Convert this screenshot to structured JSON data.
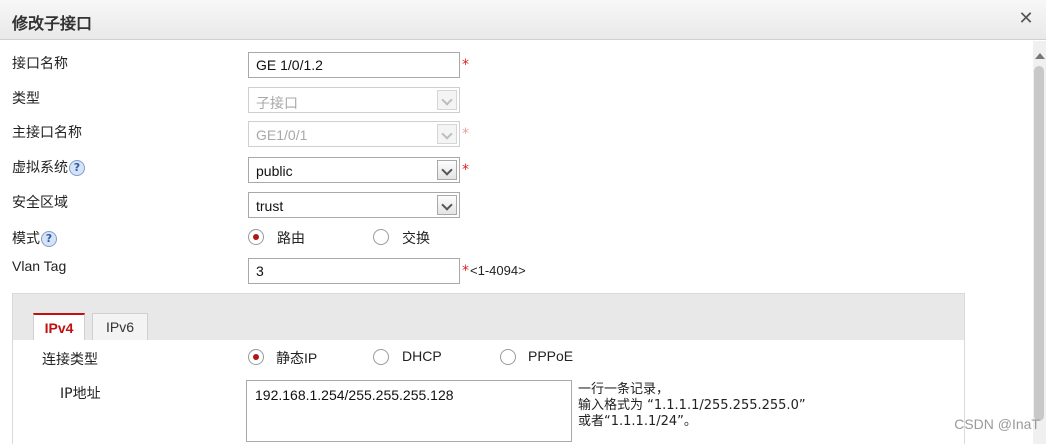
{
  "dialog": {
    "title": "修改子接口",
    "close_icon": "close-icon"
  },
  "form": {
    "interface_name": {
      "label": "接口名称",
      "value": "GE 1/0/1.2",
      "required": "*"
    },
    "type": {
      "label": "类型",
      "value": "子接口"
    },
    "main_interface": {
      "label": "主接口名称",
      "value": "GE1/0/1",
      "required": "*"
    },
    "virtual_system": {
      "label": "虚拟系统",
      "value": "public",
      "required": "*",
      "help": "?"
    },
    "security_zone": {
      "label": "安全区域",
      "value": "trust"
    },
    "mode": {
      "label": "模式",
      "help": "?",
      "options": [
        "路由",
        "交换"
      ],
      "selected": "路由"
    },
    "vlan_tag": {
      "label": "Vlan Tag",
      "value": "3",
      "required": "*",
      "range": "<1-4094>"
    }
  },
  "tabs": [
    {
      "label": "IPv4",
      "active": true
    },
    {
      "label": "IPv6",
      "active": false
    }
  ],
  "ipv4": {
    "conn_type": {
      "label": "连接类型",
      "options": [
        "静态IP",
        "DHCP",
        "PPPoE"
      ],
      "selected": "静态IP"
    },
    "ip_address": {
      "label": "IP地址",
      "value": "192.168.1.254/255.255.255.128",
      "note_lines": [
        "一行一条记录，",
        "输入格式为 “1.1.1.1/255.255.255.0”",
        "或者“1.1.1.1/24”。"
      ]
    }
  },
  "watermark": "CSDN @InaT",
  "colors": {
    "accent_red": "#c01010",
    "required_red": "#e02020"
  }
}
